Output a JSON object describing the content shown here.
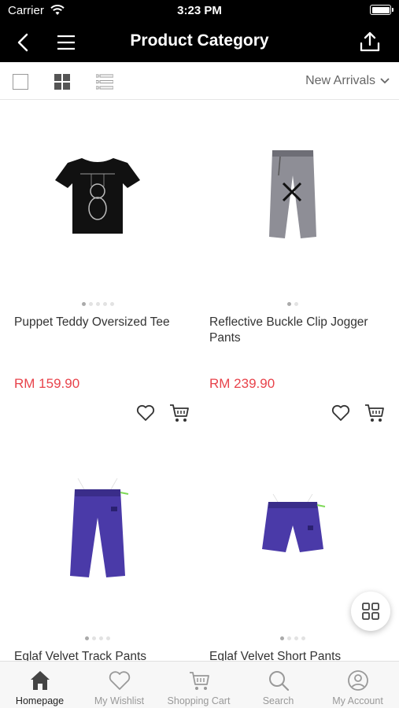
{
  "status_bar": {
    "carrier": "Carrier",
    "time": "3:23 PM"
  },
  "header": {
    "title": "Product Category",
    "icons": [
      "back-icon",
      "menu-icon",
      "share-icon"
    ]
  },
  "toolbar": {
    "sort_label": "New Arrivals",
    "view_icons": [
      "single-view-icon",
      "grid-view-icon",
      "list-view-icon"
    ]
  },
  "products": [
    {
      "name": "Puppet Teddy Oversized Tee",
      "price": "RM 159.90",
      "image_count": 5,
      "active_image": 1
    },
    {
      "name": "Reflective Buckle Clip Jogger Pants",
      "price": "RM 239.90",
      "image_count": 2,
      "active_image": 1
    },
    {
      "name": "Eglaf Velvet Track Pants",
      "price": "",
      "image_count": 4,
      "active_image": 1
    },
    {
      "name": "Eglaf Velvet Short Pants",
      "price": "",
      "image_count": 4,
      "active_image": 1
    }
  ],
  "tabs": [
    {
      "label": "Homepage",
      "icon": "home-icon",
      "active": true
    },
    {
      "label": "My Wishlist",
      "icon": "heart-icon",
      "active": false
    },
    {
      "label": "Shopping Cart",
      "icon": "cart-icon",
      "active": false
    },
    {
      "label": "Search",
      "icon": "search-icon",
      "active": false
    },
    {
      "label": "My Account",
      "icon": "account-icon",
      "active": false
    }
  ],
  "colors": {
    "header_bg": "#000000",
    "price": "#e8434b",
    "product_purple": "#4a3aa8"
  }
}
